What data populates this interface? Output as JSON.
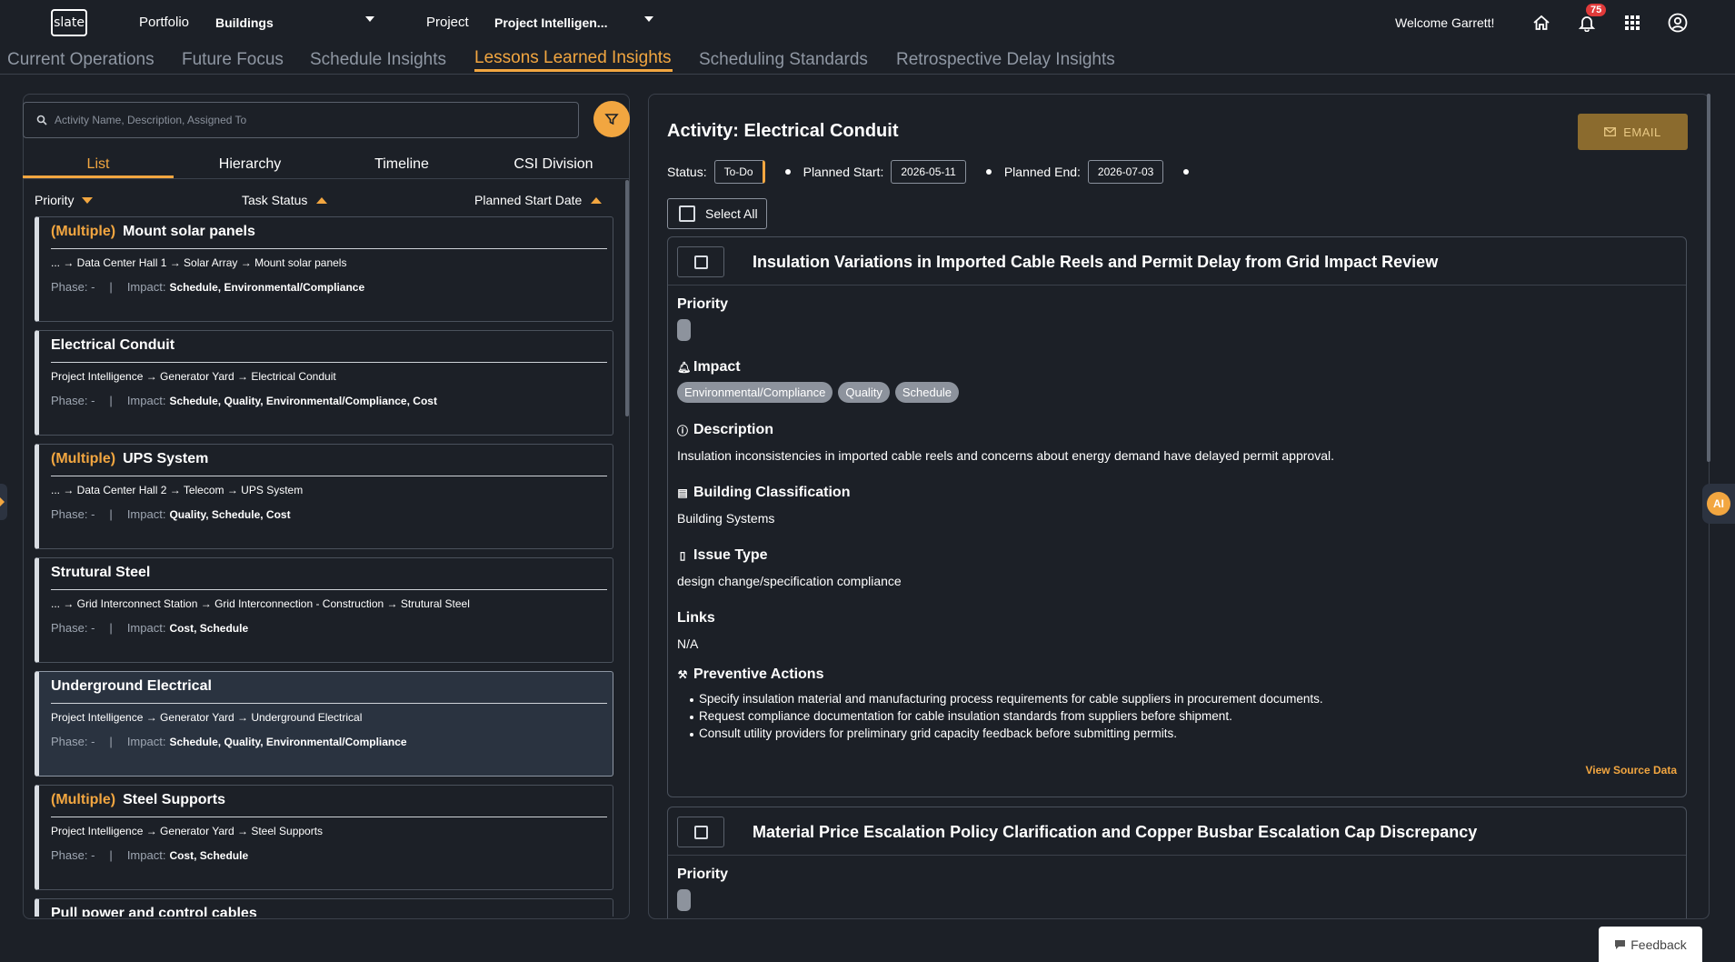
{
  "topbar": {
    "logo": "slate",
    "portfolio_label": "Portfolio",
    "portfolio_value": "Buildings",
    "project_label": "Project",
    "project_value": "Project Intelligen...",
    "welcome": "Welcome Garrett!",
    "notification_count": "75",
    "icons": [
      "home-icon",
      "bell-icon",
      "apps-grid-icon",
      "user-icon"
    ]
  },
  "tabs": [
    {
      "label": "Current Operations",
      "active": false
    },
    {
      "label": "Future Focus",
      "active": false
    },
    {
      "label": "Schedule Insights",
      "active": false
    },
    {
      "label": "Lessons Learned Insights",
      "active": true
    },
    {
      "label": "Scheduling Standards",
      "active": false
    },
    {
      "label": "Retrospective Delay Insights",
      "active": false
    }
  ],
  "left": {
    "search_placeholder": "Activity Name, Description, Assigned To",
    "view_tabs": [
      "List",
      "Hierarchy",
      "Timeline",
      "CSI Division"
    ],
    "sort": {
      "priority": "Priority",
      "task_status": "Task Status",
      "planned_start": "Planned Start Date"
    },
    "phase_label": "Phase: -",
    "impact_label": "Impact:",
    "cards": [
      {
        "prefix": "(Multiple)",
        "title": "Mount solar panels",
        "path": "... → Data Center Hall 1 → Solar Array → Mount solar panels",
        "impact": "Schedule, Environmental/Compliance"
      },
      {
        "prefix": "",
        "title": "Electrical Conduit",
        "path": "Project Intelligence → Generator Yard → Electrical Conduit",
        "impact": "Schedule, Quality, Environmental/Compliance, Cost"
      },
      {
        "prefix": "(Multiple)",
        "title": "UPS System",
        "path": "... → Data Center Hall 2 → Telecom → UPS System",
        "impact": "Quality, Schedule, Cost"
      },
      {
        "prefix": "",
        "title": "Strutural Steel",
        "path": "... → Grid Interconnect Station → Grid Interconnection - Construction → Strutural Steel",
        "impact": "Cost, Schedule"
      },
      {
        "prefix": "",
        "title": "Underground Electrical",
        "path": "Project Intelligence → Generator Yard → Underground Electrical",
        "impact": "Schedule, Quality, Environmental/Compliance"
      },
      {
        "prefix": "(Multiple)",
        "title": "Steel Supports",
        "path": "Project Intelligence → Generator Yard → Steel Supports",
        "impact": "Cost, Schedule"
      },
      {
        "prefix": "",
        "title": "Pull power and control cables",
        "path": "",
        "impact": ""
      }
    ]
  },
  "right": {
    "activity_title": "Activity: Electrical Conduit",
    "email_label": "EMAIL",
    "status_label": "Status:",
    "status_value": "To-Do",
    "planned_start_label": "Planned Start:",
    "planned_start_value": "2026-05-11",
    "planned_end_label": "Planned End:",
    "planned_end_value": "2026-07-03",
    "select_all": "Select All",
    "lessons": [
      {
        "title": "Insulation Variations in Imported Cable Reels and Permit Delay from Grid Impact Review",
        "priority_label": "Priority",
        "impact_label": "Impact",
        "impact_chips": [
          "Environmental/Compliance",
          "Quality",
          "Schedule"
        ],
        "description_label": "Description",
        "description": "Insulation inconsistencies in imported cable reels and concerns about energy demand have delayed permit approval.",
        "building_label": "Building Classification",
        "building": "Building Systems",
        "issue_label": "Issue Type",
        "issue": "design change/specification compliance",
        "links_label": "Links",
        "links": "N/A",
        "preventive_label": "Preventive Actions",
        "preventive": [
          "Specify insulation material and manufacturing process requirements for cable suppliers in procurement documents.",
          "Request compliance documentation for cable insulation standards from suppliers before shipment.",
          "Consult utility providers for preliminary grid capacity feedback before submitting permits."
        ],
        "view_source": "View Source Data"
      },
      {
        "title": "Material Price Escalation Policy Clarification and Copper Busbar Escalation Cap Discrepancy",
        "priority_label": "Priority"
      }
    ]
  },
  "ai_label": "AI",
  "feedback": "Feedback",
  "colors": {
    "accent": "#f2a640",
    "background": "#1c2027",
    "chip": "#8d939d",
    "badge": "#e03a3a"
  }
}
